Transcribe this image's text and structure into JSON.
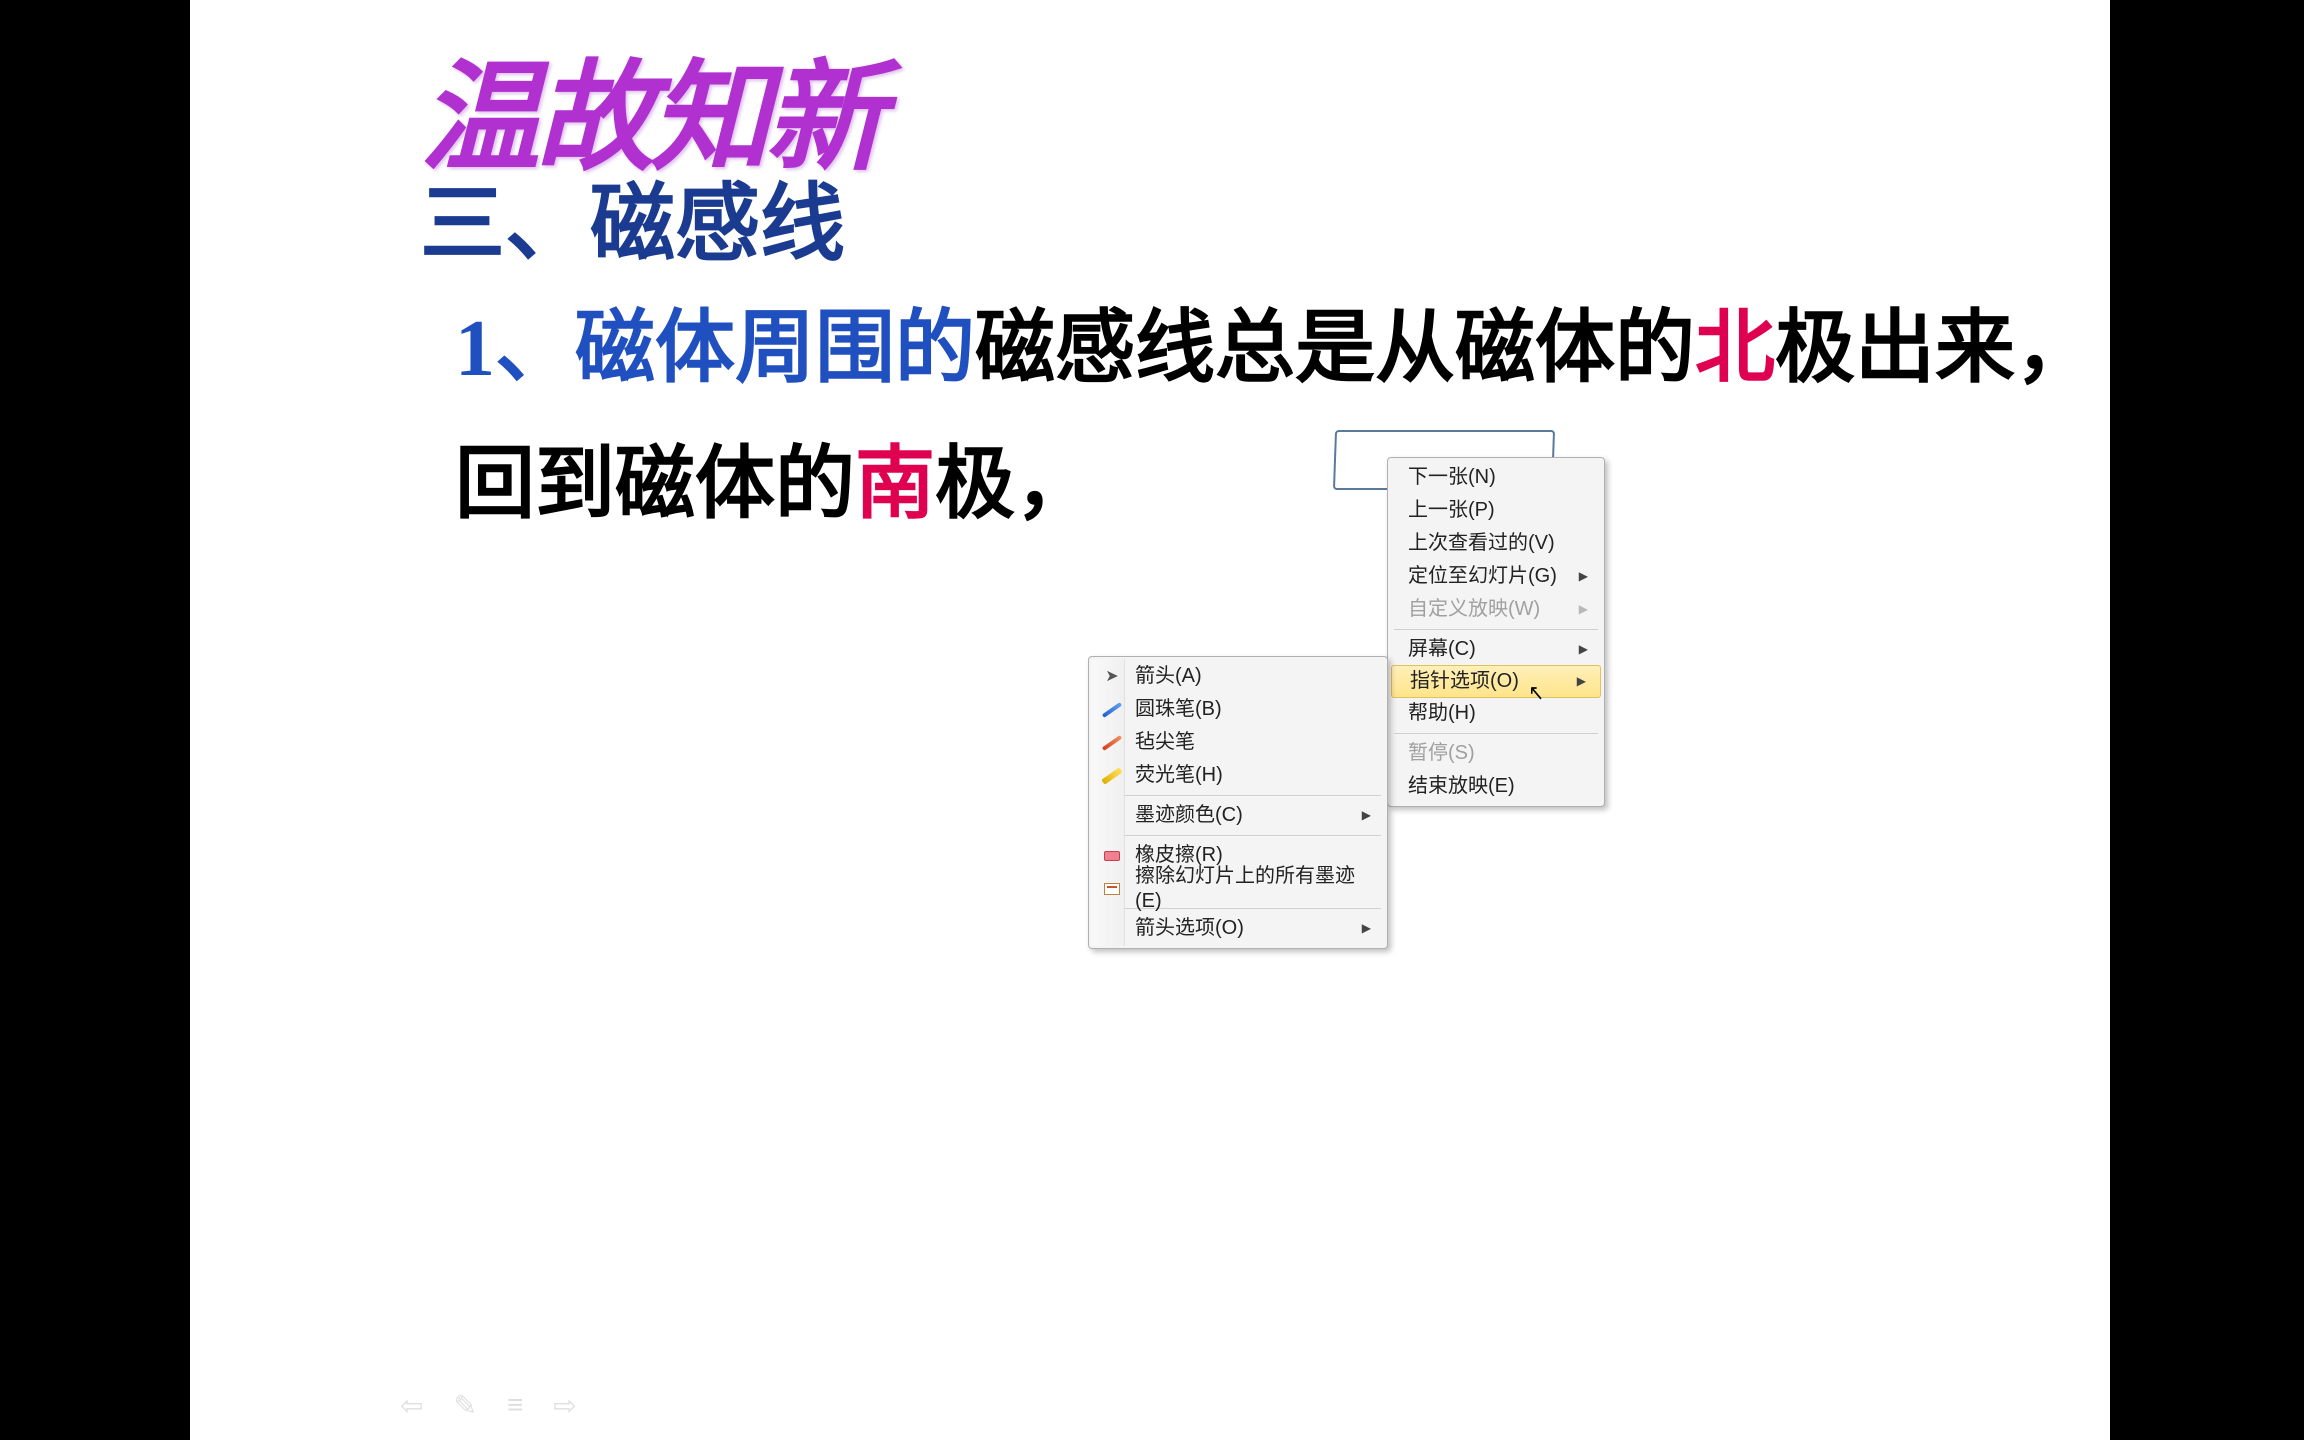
{
  "slide": {
    "decorative_title": "温故知新",
    "section_heading": "三、磁感线",
    "body": {
      "num": "1、",
      "pre": "磁体周围的",
      "mid1": "磁感线总是从磁体的",
      "north": "北",
      "mid2": "极出来，",
      "line2_pre": "回到磁体的",
      "south": "南",
      "line2_post": "极，"
    }
  },
  "context_menu": {
    "next": "下一张(N)",
    "prev": "上一张(P)",
    "last_viewed": "上次查看过的(V)",
    "goto_slide": "定位至幻灯片(G)",
    "custom_show": "自定义放映(W)",
    "screen": "屏幕(C)",
    "pointer_options": "指针选项(O)",
    "help": "帮助(H)",
    "pause": "暂停(S)",
    "end_show": "结束放映(E)"
  },
  "pointer_submenu": {
    "arrow": "箭头(A)",
    "ballpoint": "圆珠笔(B)",
    "felt_tip": "毡尖笔",
    "highlighter": "荧光笔(H)",
    "ink_color": "墨迹颜色(C)",
    "eraser": "橡皮擦(R)",
    "erase_all": "擦除幻灯片上的所有墨迹(E)",
    "arrow_options": "箭头选项(O)"
  },
  "nav": {
    "prev": "⇦",
    "pen": "✎",
    "menu": "≡",
    "next": "⇨"
  }
}
